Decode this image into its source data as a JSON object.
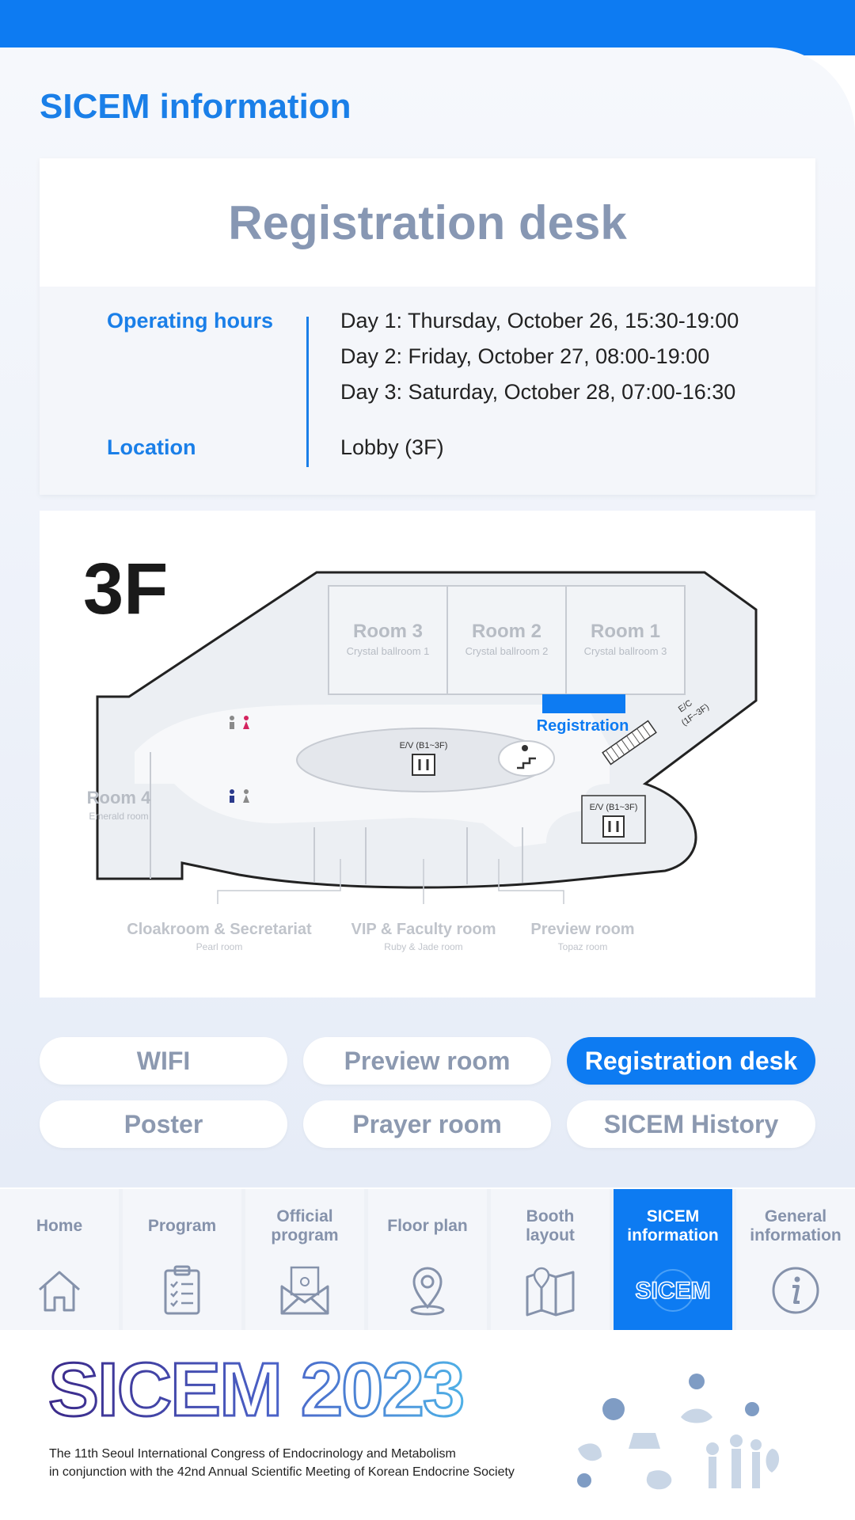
{
  "page": {
    "title": "SICEM information"
  },
  "registration": {
    "title": "Registration desk",
    "hours_label": "Operating hours",
    "days": [
      "Day 1: Thursday, October 26, 15:30-19:00",
      "Day 2: Friday, October 27, 08:00-19:00",
      "Day 3: Saturday, October 28, 07:00-16:30"
    ],
    "location_label": "Location",
    "location_value": "Lobby (3F)"
  },
  "floor_map": {
    "floor": "3F",
    "rooms": [
      {
        "name": "Room 3",
        "sub": "Crystal ballroom 1"
      },
      {
        "name": "Room 2",
        "sub": "Crystal ballroom 2"
      },
      {
        "name": "Room 1",
        "sub": "Crystal ballroom 3"
      },
      {
        "name": "Room 4",
        "sub": "Emerald room"
      }
    ],
    "registration_label": "Registration",
    "ev_center": "E/V (B1~3F)",
    "ev_right": "E/V (B1~3F)",
    "escalator_a": "E/C",
    "escalator_b": "(1F~3F)",
    "bottom_rooms": [
      {
        "name": "Cloakroom & Secretariat",
        "sub": "Pearl room"
      },
      {
        "name": "VIP & Faculty room",
        "sub": "Ruby & Jade room"
      },
      {
        "name": "Preview room",
        "sub": "Topaz room"
      }
    ],
    "accent": "#0d7bf2"
  },
  "info_tabs": [
    {
      "label": "WIFI",
      "active": false
    },
    {
      "label": "Preview room",
      "active": false
    },
    {
      "label": "Registration desk",
      "active": true
    },
    {
      "label": "Poster",
      "active": false
    },
    {
      "label": "Prayer room",
      "active": false
    },
    {
      "label": "SICEM History",
      "active": false
    }
  ],
  "bottom_nav": [
    {
      "label": "Home",
      "icon": "home-icon"
    },
    {
      "label": "Program",
      "icon": "clipboard-icon"
    },
    {
      "label": "Official\nprogram",
      "icon": "envelope-icon"
    },
    {
      "label": "Floor plan",
      "icon": "location-pin-icon"
    },
    {
      "label": "Booth\nlayout",
      "icon": "map-icon"
    },
    {
      "label": "SICEM\ninformation",
      "icon": "sicem-logo-icon",
      "active": true
    },
    {
      "label": "General\ninformation",
      "icon": "info-icon"
    }
  ],
  "footer": {
    "logo": "SICEM 2023",
    "sicem_icon_text": "SICEM",
    "line1": "The 11th Seoul International Congress of Endocrinology and Metabolism",
    "line2": "in conjunction with the 42nd Annual Scientific Meeting of Korean Endocrine Society"
  },
  "colors": {
    "brand": "#0d7bf2",
    "muted": "#8c99b0",
    "label": "#1a7fe8"
  }
}
